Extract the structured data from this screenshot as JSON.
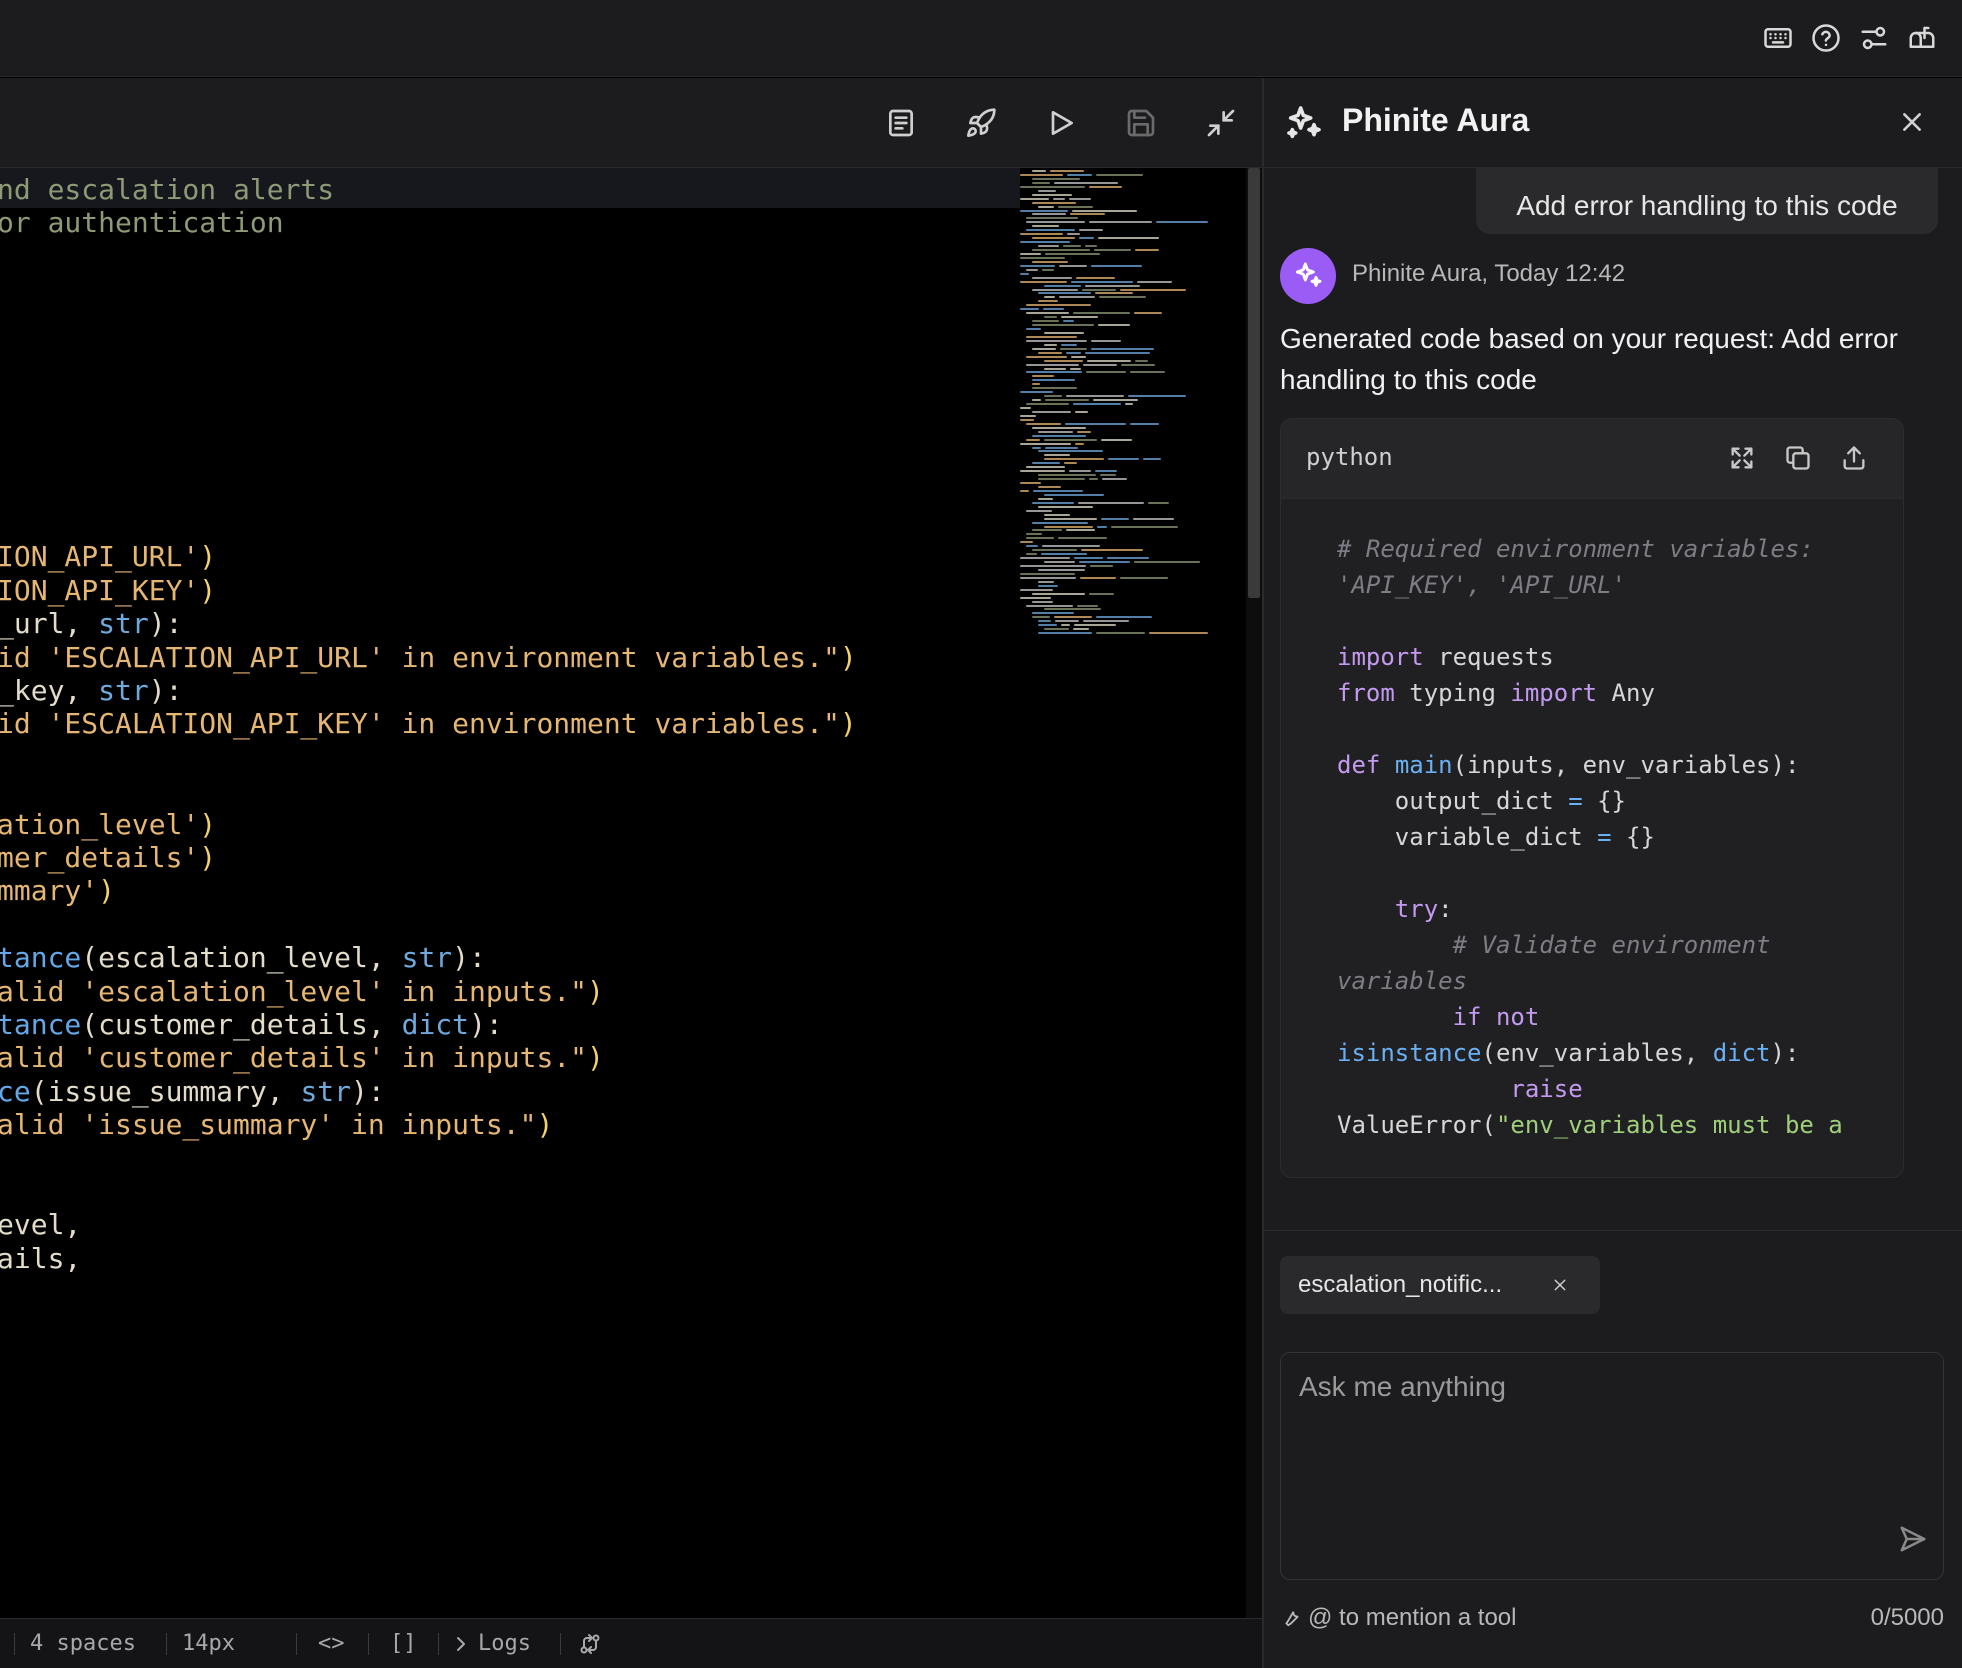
{
  "editor": {
    "lines": [
      [
        {
          "t": "nd escalation alerts",
          "c": "cm"
        }
      ],
      [
        {
          "t": "or authentication",
          "c": "cm"
        }
      ],
      [],
      [],
      [],
      [],
      [],
      [],
      [],
      [],
      [],
      [
        {
          "t": "ION_API_URL'",
          "c": "str"
        },
        {
          "t": ")",
          "c": "p"
        }
      ],
      [
        {
          "t": "ION_API_KEY'",
          "c": "str"
        },
        {
          "t": ")",
          "c": "p"
        }
      ],
      [
        {
          "t": "_url, ",
          "c": "var"
        },
        {
          "t": "str",
          "c": "kw"
        },
        {
          "t": "):",
          "c": "var"
        }
      ],
      [
        {
          "t": "id 'ESCALATION_API_URL' in environment variables.\"",
          "c": "str"
        },
        {
          "t": ")",
          "c": "p"
        }
      ],
      [
        {
          "t": "_key, ",
          "c": "var"
        },
        {
          "t": "str",
          "c": "kw"
        },
        {
          "t": "):",
          "c": "var"
        }
      ],
      [
        {
          "t": "id 'ESCALATION_API_KEY' in environment variables.\"",
          "c": "str"
        },
        {
          "t": ")",
          "c": "p"
        }
      ],
      [],
      [],
      [
        {
          "t": "ation_level'",
          "c": "str"
        },
        {
          "t": ")",
          "c": "p"
        }
      ],
      [
        {
          "t": "mer_details'",
          "c": "str"
        },
        {
          "t": ")",
          "c": "p"
        }
      ],
      [
        {
          "t": "mmary'",
          "c": "str"
        },
        {
          "t": ")",
          "c": "p"
        }
      ],
      [],
      [
        {
          "t": "tance",
          "c": "fn"
        },
        {
          "t": "(escalation_level, ",
          "c": "var"
        },
        {
          "t": "str",
          "c": "kw"
        },
        {
          "t": "):",
          "c": "var"
        }
      ],
      [
        {
          "t": "alid 'escalation_level' in inputs.\"",
          "c": "str"
        },
        {
          "t": ")",
          "c": "p"
        }
      ],
      [
        {
          "t": "tance",
          "c": "fn"
        },
        {
          "t": "(customer_details, ",
          "c": "var"
        },
        {
          "t": "dict",
          "c": "kw"
        },
        {
          "t": "):",
          "c": "var"
        }
      ],
      [
        {
          "t": "alid 'customer_details' in inputs.\"",
          "c": "str"
        },
        {
          "t": ")",
          "c": "p"
        }
      ],
      [
        {
          "t": "ce",
          "c": "fn"
        },
        {
          "t": "(issue_summary, ",
          "c": "var"
        },
        {
          "t": "str",
          "c": "kw"
        },
        {
          "t": "):",
          "c": "var"
        }
      ],
      [
        {
          "t": "alid 'issue_summary' in inputs.\"",
          "c": "str"
        },
        {
          "t": ")",
          "c": "p"
        }
      ],
      [],
      [],
      [
        {
          "t": "evel,",
          "c": "var"
        }
      ],
      [
        {
          "t": "ails,",
          "c": "var"
        }
      ]
    ]
  },
  "statusbar": {
    "indent": "4 spaces",
    "font_size": "14px",
    "format_label": "<>",
    "brackets_label": "[]",
    "logs_label": "Logs"
  },
  "aura": {
    "title": "Phinite Aura",
    "user_message": "Add error handling to this code",
    "assistant_meta": "Phinite Aura, Today 12:42",
    "assistant_message": "Generated code based on your request: Add error handling to this code",
    "code_block": {
      "language": "python",
      "lines": [
        [
          {
            "t": "# Required environment variables:",
            "c": "cm"
          }
        ],
        [
          {
            "t": "'API_KEY', 'API_URL'",
            "c": "cm"
          }
        ],
        [],
        [
          {
            "t": "import",
            "c": "kw"
          },
          {
            "t": " requests"
          }
        ],
        [
          {
            "t": "from",
            "c": "kw"
          },
          {
            "t": " typing "
          },
          {
            "t": "import",
            "c": "kw"
          },
          {
            "t": " Any"
          }
        ],
        [],
        [
          {
            "t": "def",
            "c": "kw"
          },
          {
            "t": " "
          },
          {
            "t": "main",
            "c": "fn"
          },
          {
            "t": "(inputs, env_variables):"
          }
        ],
        [
          {
            "t": "    output_dict "
          },
          {
            "t": "=",
            "c": "op"
          },
          {
            "t": " {}"
          }
        ],
        [
          {
            "t": "    variable_dict "
          },
          {
            "t": "=",
            "c": "op"
          },
          {
            "t": " {}"
          }
        ],
        [],
        [
          {
            "t": "    "
          },
          {
            "t": "try",
            "c": "kw"
          },
          {
            "t": ":"
          }
        ],
        [
          {
            "t": "        # Validate environment",
            "c": "cm"
          }
        ],
        [
          {
            "t": "variables",
            "c": "cm"
          }
        ],
        [
          {
            "t": "        "
          },
          {
            "t": "if",
            "c": "kw"
          },
          {
            "t": " "
          },
          {
            "t": "not",
            "c": "kw"
          }
        ],
        [
          {
            "t": "isinstance",
            "c": "fn"
          },
          {
            "t": "(env_variables, "
          },
          {
            "t": "dict",
            "c": "bi"
          },
          {
            "t": "):"
          }
        ],
        [
          {
            "t": "            "
          },
          {
            "t": "raise",
            "c": "kw"
          }
        ],
        [
          {
            "t": "ValueError("
          },
          {
            "t": "\"env_variables must be a",
            "c": "str"
          }
        ]
      ]
    },
    "context_chip": "escalation_notific...",
    "prompt_placeholder": "Ask me anything",
    "mention_hint": "@ to mention a tool",
    "char_count": "0/5000"
  },
  "icons": {
    "top": [
      "keyboard-icon",
      "help-icon",
      "settings-sliders-icon",
      "mailbox-icon"
    ],
    "toolbar": [
      "document-icon",
      "rocket-icon",
      "play-icon",
      "save-icon",
      "minimize-icon"
    ],
    "code_block": [
      "expand-icon",
      "copy-icon",
      "export-icon"
    ]
  },
  "colors": {
    "assistant_avatar": "#9b5cf6",
    "panel_bg": "#1c1c1e",
    "editor_bg": "#000000"
  }
}
